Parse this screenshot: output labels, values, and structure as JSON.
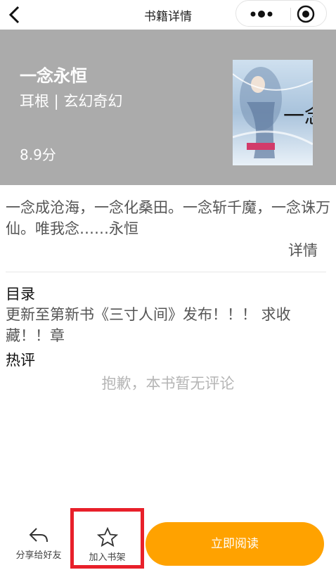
{
  "navbar": {
    "title": "书籍详情",
    "back_icon": "chevron-left-icon",
    "more_icon": "more-dots-icon",
    "close_icon": "target-circle-icon"
  },
  "book": {
    "title": "一念永恒",
    "meta": "耳根 | 玄幻奇幻",
    "score": "8.9分",
    "cover_title": "一念永恒",
    "header_bg": "#ababab"
  },
  "intro": {
    "text": "一念成沧海，一念化桑田。一念斩千魔，一念诛万仙。唯我念……永恒",
    "detail_label": "详情"
  },
  "catalog": {
    "title": "目录",
    "latest": "更新至第新书《三寸人间》发布！！！ 求收藏！！章"
  },
  "reviews": {
    "title": "热评",
    "empty_text": "抱歉，本书暂无评论"
  },
  "bottom": {
    "share_label": "分享给好友",
    "share_icon": "share-arrow-icon",
    "shelf_label": "加入书架",
    "shelf_icon": "star-icon",
    "read_label": "立即阅读",
    "read_color": "#ffa200",
    "highlight_color": "#e8202a"
  }
}
